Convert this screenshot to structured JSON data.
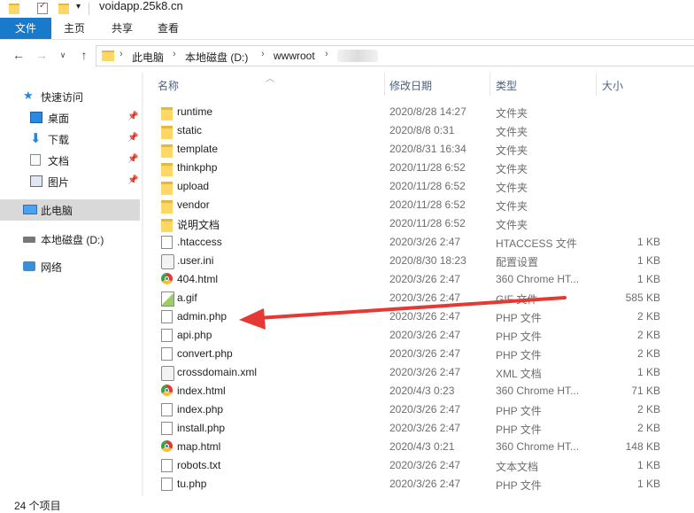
{
  "window": {
    "title": "voidapp.25k8.cn"
  },
  "ribbon": {
    "tabs": [
      "文件",
      "主页",
      "共享",
      "查看"
    ]
  },
  "address": {
    "crumbs": [
      "此电脑",
      "本地磁盘 (D:)",
      "wwwroot"
    ]
  },
  "nav": {
    "quick_access": "快速访问",
    "items": [
      {
        "label": "桌面",
        "icon": "desktop-icon",
        "pinned": true
      },
      {
        "label": "下载",
        "icon": "download-icon",
        "pinned": true
      },
      {
        "label": "文档",
        "icon": "documents-icon",
        "pinned": true
      },
      {
        "label": "图片",
        "icon": "pictures-icon",
        "pinned": true
      }
    ],
    "this_pc": "此电脑",
    "local_disk": "本地磁盘 (D:)",
    "network": "网络"
  },
  "columns": {
    "name": "名称",
    "date": "修改日期",
    "type": "类型",
    "size": "大小"
  },
  "files": [
    {
      "name": "runtime",
      "date": "2020/8/28 14:27",
      "type": "文件夹",
      "size": "",
      "icon": "folder"
    },
    {
      "name": "static",
      "date": "2020/8/8 0:31",
      "type": "文件夹",
      "size": "",
      "icon": "folder"
    },
    {
      "name": "template",
      "date": "2020/8/31 16:34",
      "type": "文件夹",
      "size": "",
      "icon": "folder"
    },
    {
      "name": "thinkphp",
      "date": "2020/11/28 6:52",
      "type": "文件夹",
      "size": "",
      "icon": "folder"
    },
    {
      "name": "upload",
      "date": "2020/11/28 6:52",
      "type": "文件夹",
      "size": "",
      "icon": "folder"
    },
    {
      "name": "vendor",
      "date": "2020/11/28 6:52",
      "type": "文件夹",
      "size": "",
      "icon": "folder"
    },
    {
      "name": "说明文档",
      "date": "2020/11/28 6:52",
      "type": "文件夹",
      "size": "",
      "icon": "folder"
    },
    {
      "name": ".htaccess",
      "date": "2020/3/26 2:47",
      "type": "HTACCESS 文件",
      "size": "1 KB",
      "icon": "doc"
    },
    {
      "name": ".user.ini",
      "date": "2020/8/30 18:23",
      "type": "配置设置",
      "size": "1 KB",
      "icon": "gear"
    },
    {
      "name": "404.html",
      "date": "2020/3/26 2:47",
      "type": "360 Chrome HT...",
      "size": "1 KB",
      "icon": "chrome"
    },
    {
      "name": "a.gif",
      "date": "2020/3/26 2:47",
      "type": "GIF 文件",
      "size": "585 KB",
      "icon": "img"
    },
    {
      "name": "admin.php",
      "date": "2020/3/26 2:47",
      "type": "PHP 文件",
      "size": "2 KB",
      "icon": "doc"
    },
    {
      "name": "api.php",
      "date": "2020/3/26 2:47",
      "type": "PHP 文件",
      "size": "2 KB",
      "icon": "doc"
    },
    {
      "name": "convert.php",
      "date": "2020/3/26 2:47",
      "type": "PHP 文件",
      "size": "2 KB",
      "icon": "doc"
    },
    {
      "name": "crossdomain.xml",
      "date": "2020/3/26 2:47",
      "type": "XML 文档",
      "size": "1 KB",
      "icon": "gear"
    },
    {
      "name": "index.html",
      "date": "2020/4/3 0:23",
      "type": "360 Chrome HT...",
      "size": "71 KB",
      "icon": "chrome"
    },
    {
      "name": "index.php",
      "date": "2020/3/26 2:47",
      "type": "PHP 文件",
      "size": "2 KB",
      "icon": "doc"
    },
    {
      "name": "install.php",
      "date": "2020/3/26 2:47",
      "type": "PHP 文件",
      "size": "2 KB",
      "icon": "doc"
    },
    {
      "name": "map.html",
      "date": "2020/4/3 0:21",
      "type": "360 Chrome HT...",
      "size": "148 KB",
      "icon": "chrome"
    },
    {
      "name": "robots.txt",
      "date": "2020/3/26 2:47",
      "type": "文本文档",
      "size": "1 KB",
      "icon": "doc"
    },
    {
      "name": "tu.php",
      "date": "2020/3/26 2:47",
      "type": "PHP 文件",
      "size": "1 KB",
      "icon": "doc"
    }
  ],
  "status": {
    "count": "24 个项目"
  },
  "colors": {
    "file_tab": "#1979ca",
    "annotation_arrow": "#e53935",
    "folder": "#ffd764"
  }
}
